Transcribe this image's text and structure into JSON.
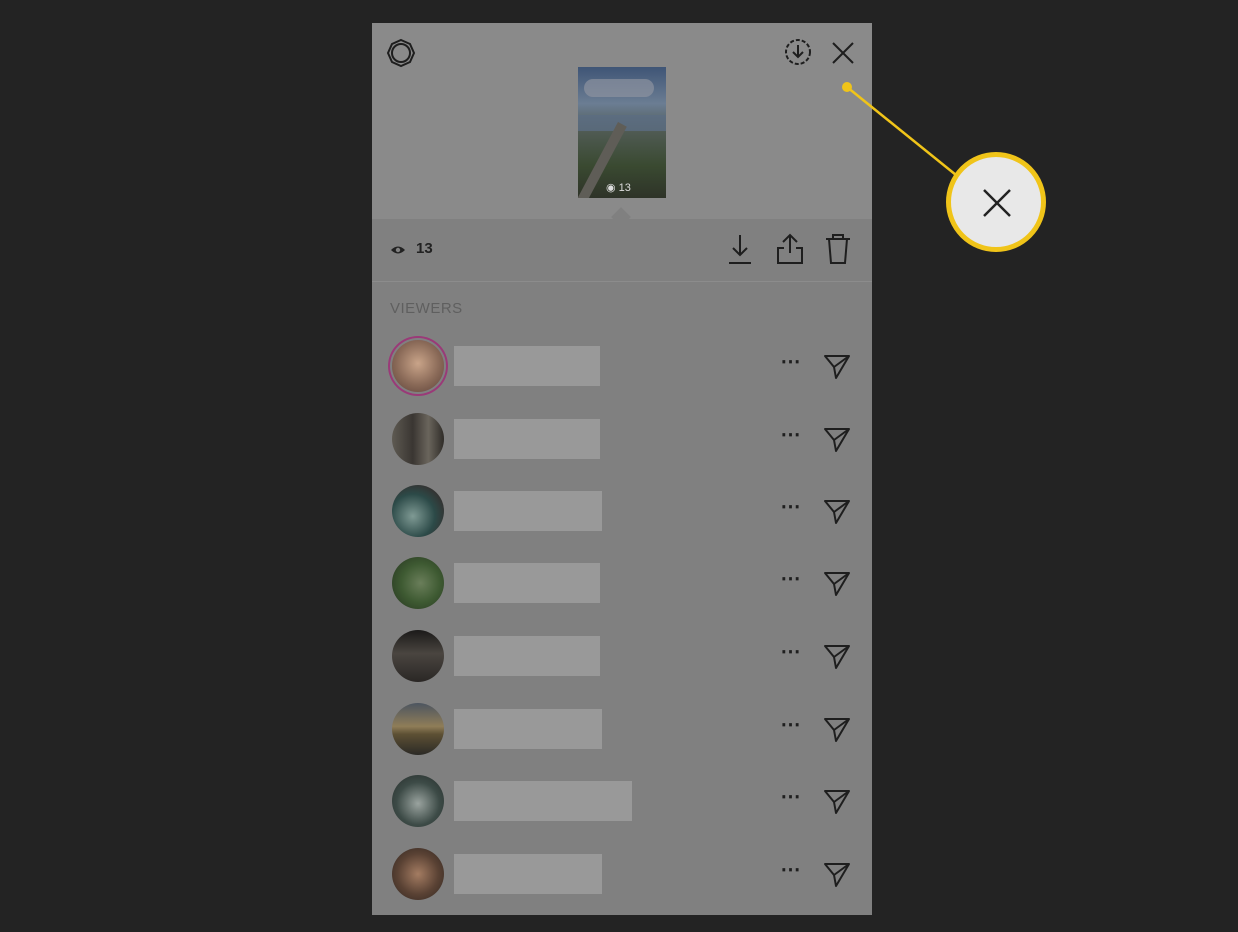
{
  "story_viewer": {
    "view_count": "13",
    "thumbnail_count": "13",
    "viewers_heading": "VIEWERS",
    "icons": {
      "settings": "settings-gear-icon",
      "download_circle": "download-circle-icon",
      "close": "close-icon",
      "eye": "eye-icon",
      "download": "download-icon",
      "share": "share-icon",
      "delete": "trash-icon"
    },
    "viewers": [
      {
        "more": "⋯",
        "avatar_color": "#8a6a58"
      },
      {
        "more": "⋯",
        "avatar_color": "#4b4843"
      },
      {
        "more": "⋯",
        "avatar_color": "#2c4a48"
      },
      {
        "more": "⋯",
        "avatar_color": "#3e5a32"
      },
      {
        "more": "⋯",
        "avatar_color": "#2a2725"
      },
      {
        "more": "⋯",
        "avatar_color": "#5d5034"
      },
      {
        "more": "⋯",
        "avatar_color": "#3d4b47"
      },
      {
        "more": "⋯",
        "avatar_color": "#5a4234"
      }
    ]
  },
  "callout": {
    "highlight_color": "#f0c419",
    "icon": "close-icon"
  }
}
